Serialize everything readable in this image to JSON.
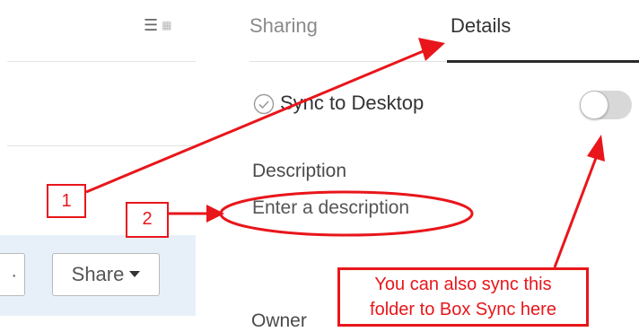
{
  "left_pane": {
    "view_icons": [
      "list-view-icon",
      "grid-view-icon"
    ],
    "more_label": "·",
    "share_label": "Share"
  },
  "tabs": [
    {
      "label": "Sharing",
      "active": false
    },
    {
      "label": "Details",
      "active": true
    }
  ],
  "details": {
    "sync_label": "Sync to Desktop",
    "sync_enabled": false,
    "description_label": "Description",
    "description_placeholder": "Enter a description",
    "description_value": "",
    "owner_label": "Owner"
  },
  "annotations": {
    "callout_1": "1",
    "callout_2": "2",
    "note_line_1": "You can also sync this",
    "note_line_2": "folder to Box Sync here"
  },
  "colors": {
    "annotation_red": "#e8161b",
    "action_bar_bg": "#e7f0f9",
    "tab_underline": "#2a2a2a"
  }
}
